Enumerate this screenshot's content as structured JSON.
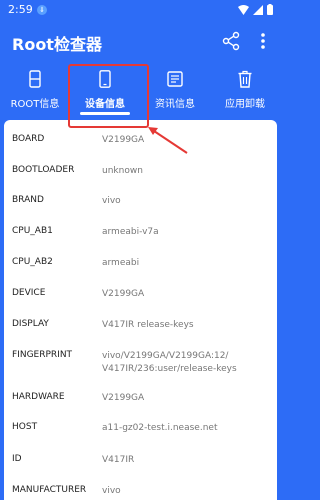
{
  "status_bar": {
    "time": "2:59",
    "notification_badge": "⇓"
  },
  "app_bar": {
    "title": "Root检查器"
  },
  "tabs": [
    {
      "label": "ROOT信息",
      "icon": "sd-card-icon"
    },
    {
      "label": "设备信息",
      "icon": "phone-icon",
      "active": true
    },
    {
      "label": "资讯信息",
      "icon": "news-icon"
    },
    {
      "label": "应用卸载",
      "icon": "trash-icon"
    }
  ],
  "rows": [
    {
      "key": "BOARD",
      "value": "V2199GA"
    },
    {
      "key": "BOOTLOADER",
      "value": "unknown"
    },
    {
      "key": "BRAND",
      "value": "vivo"
    },
    {
      "key": "CPU_AB1",
      "value": "armeabi-v7a"
    },
    {
      "key": "CPU_AB2",
      "value": "armeabi"
    },
    {
      "key": "DEVICE",
      "value": "V2199GA"
    },
    {
      "key": "DISPLAY",
      "value": "V417IR release-keys"
    },
    {
      "key": "FINGERPRINT",
      "value": "vivo/V2199GA/V2199GA:12/",
      "value2": "V417IR/236:user/release-keys"
    },
    {
      "key": "HARDWARE",
      "value": "V2199GA"
    },
    {
      "key": "HOST",
      "value": "a11-gz02-test.i.nease.net"
    },
    {
      "key": "ID",
      "value": "V417IR"
    },
    {
      "key": "MANUFACTURER",
      "value": "vivo"
    }
  ],
  "colors": {
    "primary": "#2d6cf6",
    "highlight": "#e53935"
  }
}
